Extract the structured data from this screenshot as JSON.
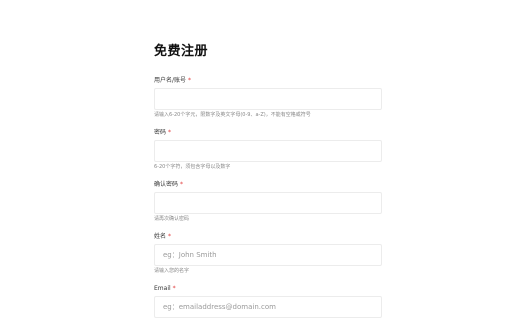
{
  "form": {
    "title": "免费注册",
    "required_mark": "*",
    "fields": [
      {
        "label": "用户名/账号",
        "value": "",
        "placeholder": "",
        "hint": "请输入6-20个字元，限数字及英文字母(0-9、a-Z)，不能有空格或符号"
      },
      {
        "label": "密码",
        "value": "",
        "placeholder": "",
        "hint": "6-20个字符，须包含字母以及数字"
      },
      {
        "label": "确认密码",
        "value": "",
        "placeholder": "",
        "hint": "请再次确认密码"
      },
      {
        "label": "姓名",
        "value": "",
        "placeholder": "eg：John Smith",
        "hint": "请输入您的名字"
      },
      {
        "label": "Email",
        "value": "",
        "placeholder": "eg：emailaddress@domain.com",
        "hint": ""
      }
    ]
  },
  "colors": {
    "required": "#e03a3a",
    "hint": "#888888",
    "border": "#ececec"
  }
}
